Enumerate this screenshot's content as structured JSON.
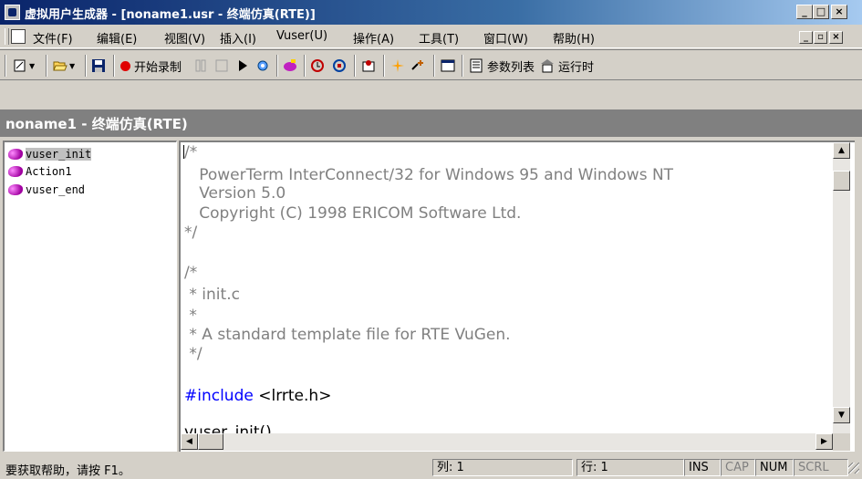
{
  "window": {
    "title": "虚拟用户生成器 - [noname1.usr - 终端仿真(RTE)]",
    "minimize": "_",
    "maximize": "□",
    "close": "×"
  },
  "menubar": {
    "items": [
      "文件(F)",
      "编辑(E)",
      "视图(V)",
      "插入(I)",
      "Vuser(U)",
      "操作(A)",
      "工具(T)",
      "窗口(W)",
      "帮助(H)"
    ],
    "mdi_buttons": [
      "_",
      "▫",
      "×"
    ]
  },
  "toolbar": {
    "record_label": "开始录制",
    "params_label": "参数列表",
    "run_label": "运行时"
  },
  "document": {
    "header": "noname1 - 终端仿真(RTE)"
  },
  "tree": {
    "items": [
      "vuser_init",
      "Action1",
      "vuser_end"
    ],
    "selected": "vuser_init"
  },
  "editor": {
    "lines": [
      "/*",
      "   PowerTerm InterConnect/32 for Windows 95 and Windows NT",
      "   Version 5.0",
      "   Copyright (C) 1998 ERICOM Software Ltd.",
      "*/",
      "",
      "/*",
      " * init.c",
      " *",
      " * A standard template file for RTE VuGen.",
      " */",
      "",
      "#include <lrrte.h>",
      "",
      "vuser_init()"
    ],
    "include_keyword": "#include",
    "include_rest": " <lrrte.h>"
  },
  "statusbar": {
    "help": "要获取帮助，请按 F1。",
    "col": "列: 1",
    "row": "行: 1",
    "ins": "INS",
    "cap": "CAP",
    "num": "NUM",
    "scrl": "SCRL"
  }
}
